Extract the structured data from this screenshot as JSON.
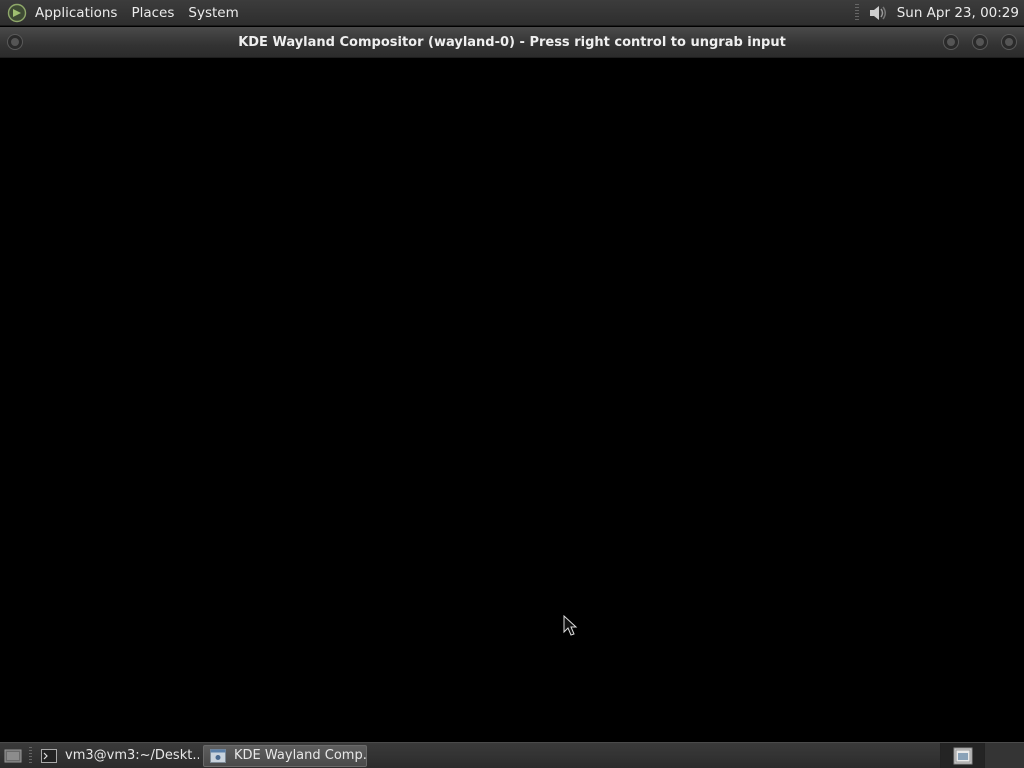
{
  "top_panel": {
    "menus": [
      "Applications",
      "Places",
      "System"
    ],
    "clock": "Sun Apr 23, 00:29",
    "icons": {
      "logo": "distro-logo-icon",
      "volume": "speaker-icon"
    }
  },
  "window": {
    "title": "KDE Wayland Compositor (wayland-0) - Press right control to ungrab input",
    "controls": [
      "minimize-button",
      "maximize-button",
      "close-button"
    ]
  },
  "taskbar": {
    "tasks": [
      {
        "label": "vm3@vm3:~/Deskt...",
        "icon": "terminal-icon",
        "active": false
      },
      {
        "label": "KDE Wayland Comp...",
        "icon": "window-icon",
        "active": true
      }
    ]
  },
  "colors": {
    "panel": "#333333",
    "desktop": "#000000",
    "accent": "#7a9a5a"
  }
}
